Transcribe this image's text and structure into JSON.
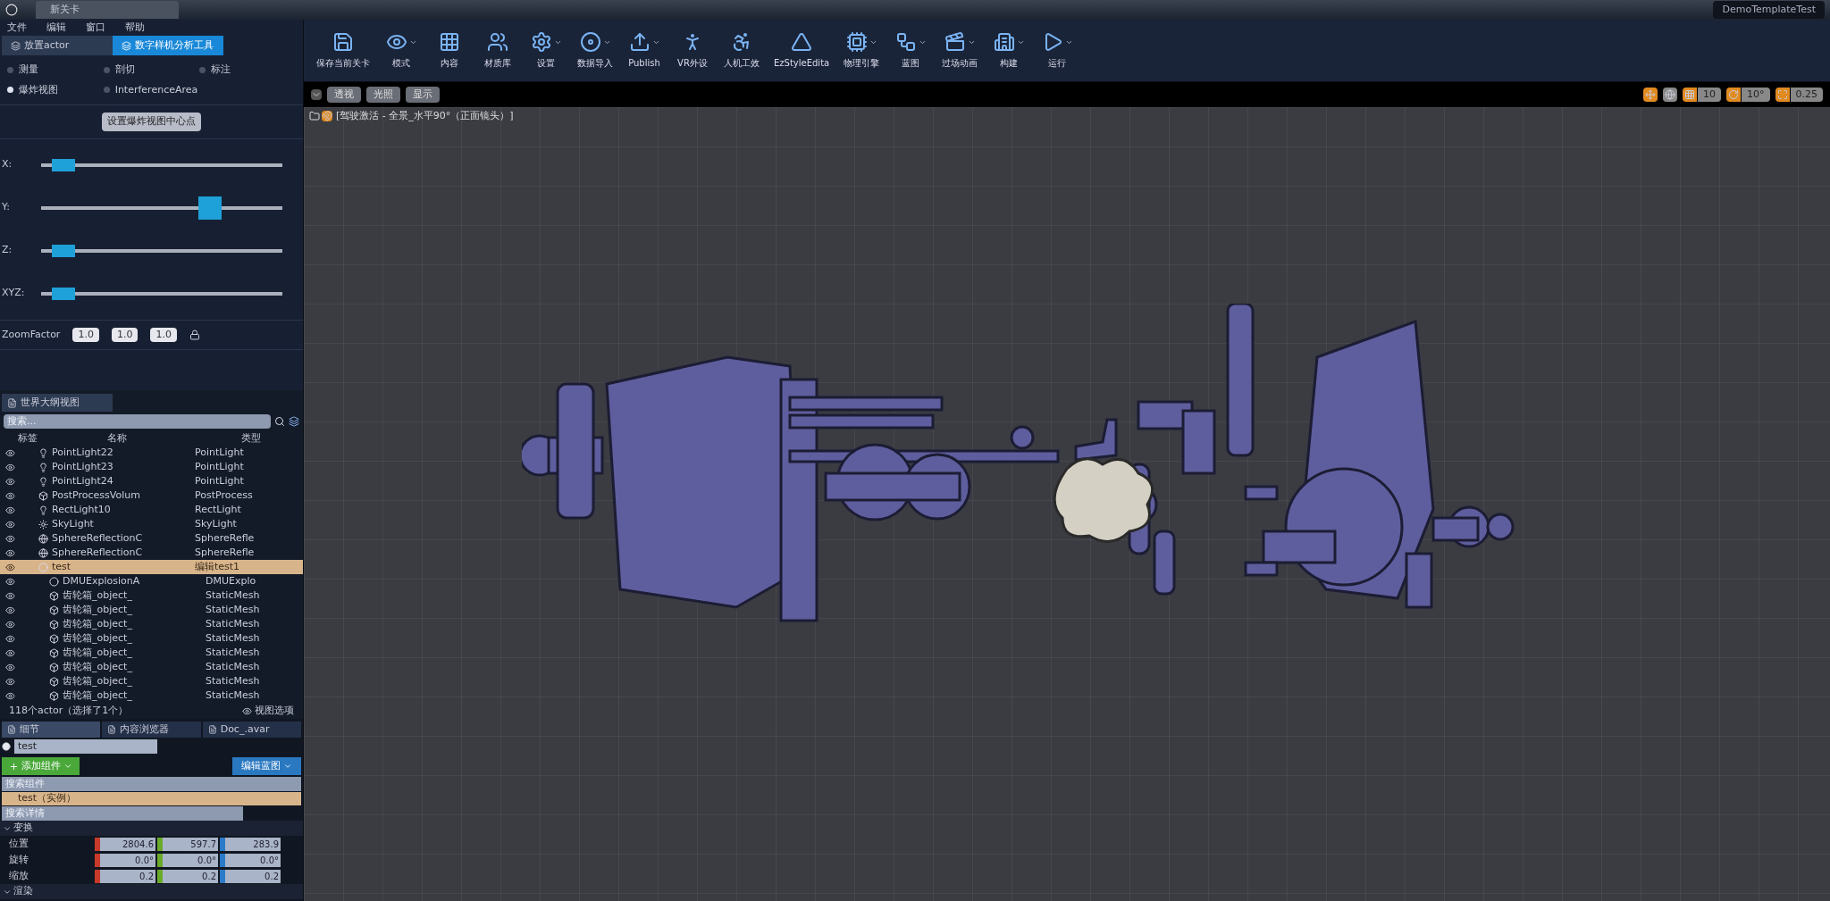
{
  "window": {
    "level_tab": "新关卡",
    "project": "DemoTemplateTest"
  },
  "menu": [
    "文件",
    "编辑",
    "窗口",
    "帮助"
  ],
  "tool_tabs": [
    {
      "label": "放置actor",
      "selected": false
    },
    {
      "label": "数字样机分析工具",
      "selected": true
    }
  ],
  "modes": [
    {
      "label": "测量",
      "selected": false
    },
    {
      "label": "剖切",
      "selected": false
    },
    {
      "label": "标注",
      "selected": false
    },
    {
      "label": "爆炸视图",
      "selected": true
    },
    {
      "label": "InterferenceArea",
      "selected": false
    }
  ],
  "center_button": "设置爆炸视图中心点",
  "sliders": [
    {
      "label": "X:",
      "level": 0.05
    },
    {
      "label": "Y:",
      "level": 0.72
    },
    {
      "label": "Z:",
      "level": 0.05
    },
    {
      "label": "XYZ:",
      "level": 0.05
    }
  ],
  "zoom_factor": {
    "label": "ZoomFactor",
    "values": [
      "1.0",
      "1.0",
      "1.0"
    ]
  },
  "outliner": {
    "tab": "世界大纲视图",
    "search_placeholder": "搜索...",
    "columns": [
      "标签",
      "名称",
      "类型"
    ],
    "rows": [
      {
        "label": "PointLight22",
        "type": "PointLight",
        "selected": false
      },
      {
        "label": "PointLight23",
        "type": "PointLight",
        "selected": false
      },
      {
        "label": "PointLight24",
        "type": "PointLight",
        "selected": false
      },
      {
        "label": "PostProcessVolum",
        "type": "PostProcess",
        "selected": false
      },
      {
        "label": "RectLight10",
        "type": "RectLight",
        "selected": false
      },
      {
        "label": "SkyLight",
        "type": "SkyLight",
        "selected": false
      },
      {
        "label": "SphereReflectionC",
        "type": "SphereRefle",
        "selected": false
      },
      {
        "label": "SphereReflectionC",
        "type": "SphereRefle",
        "selected": false
      },
      {
        "label": "test",
        "type": "编辑test1",
        "selected": true,
        "children": [
          {
            "label": "DMUExplosionA",
            "type": "DMUExplo",
            "selected": false
          },
          {
            "label": "齿轮箱_object_",
            "type": "StaticMesh",
            "selected": false
          },
          {
            "label": "齿轮箱_object_",
            "type": "StaticMesh",
            "selected": false
          },
          {
            "label": "齿轮箱_object_",
            "type": "StaticMesh",
            "selected": false
          },
          {
            "label": "齿轮箱_object_",
            "type": "StaticMesh",
            "selected": false
          },
          {
            "label": "齿轮箱_object_",
            "type": "StaticMesh",
            "selected": false
          },
          {
            "label": "齿轮箱_object_",
            "type": "StaticMesh",
            "selected": false
          },
          {
            "label": "齿轮箱_object_",
            "type": "StaticMesh",
            "selected": false
          },
          {
            "label": "齿轮箱_object_",
            "type": "StaticMesh",
            "selected": false
          }
        ]
      }
    ],
    "footer": "118个actor（选择了1个）",
    "view_options": "视图选项"
  },
  "details": {
    "tabs": [
      {
        "label": "细节",
        "selected": true
      },
      {
        "label": "内容浏览器",
        "selected": false
      },
      {
        "label": "Doc_.avar",
        "selected": false
      }
    ],
    "name": "test",
    "add_component": "添加组件",
    "edit_blueprint": "编辑蓝图",
    "component_search_placeholder": "搜索组件",
    "component": "test（实例）",
    "detail_search_placeholder": "搜索详情",
    "sections": [
      {
        "title": "变换",
        "expanded": true,
        "rows": [
          {
            "label": "位置",
            "values": [
              "2804.6",
              "597.7",
              "283.9"
            ]
          },
          {
            "label": "旋转",
            "values": [
              "0.0°",
              "0.0°",
              "0.0°"
            ]
          },
          {
            "label": "缩放",
            "values": [
              "0.2",
              "0.2",
              "0.2"
            ]
          }
        ]
      },
      {
        "title": "渲染",
        "expanded": true
      }
    ]
  },
  "toolbar": [
    {
      "label": "保存当前关卡",
      "dropdown": false
    },
    {
      "label": "模式",
      "dropdown": true
    },
    {
      "label": "内容",
      "dropdown": false
    },
    {
      "label": "材质库",
      "dropdown": false
    },
    {
      "label": "设置",
      "dropdown": true
    },
    {
      "label": "数据导入",
      "dropdown": true
    },
    {
      "label": "Publish",
      "dropdown": true
    },
    {
      "label": "VR外设",
      "dropdown": false
    },
    {
      "label": "人机工效",
      "dropdown": false
    },
    {
      "label": "EzStyleEdita",
      "dropdown": false
    },
    {
      "label": "物理引擎",
      "dropdown": true
    },
    {
      "label": "蓝图",
      "dropdown": true
    },
    {
      "label": "过场动画",
      "dropdown": true
    },
    {
      "label": "构建",
      "dropdown": true
    },
    {
      "label": "运行",
      "dropdown": true
    }
  ],
  "viewport": {
    "buttons": [
      "透视",
      "光照",
      "显示"
    ],
    "caption": "[驾驶激活 - 全景_水平90°（正面镜头）]",
    "snaps": [
      "10",
      "10°",
      "0.25"
    ]
  }
}
